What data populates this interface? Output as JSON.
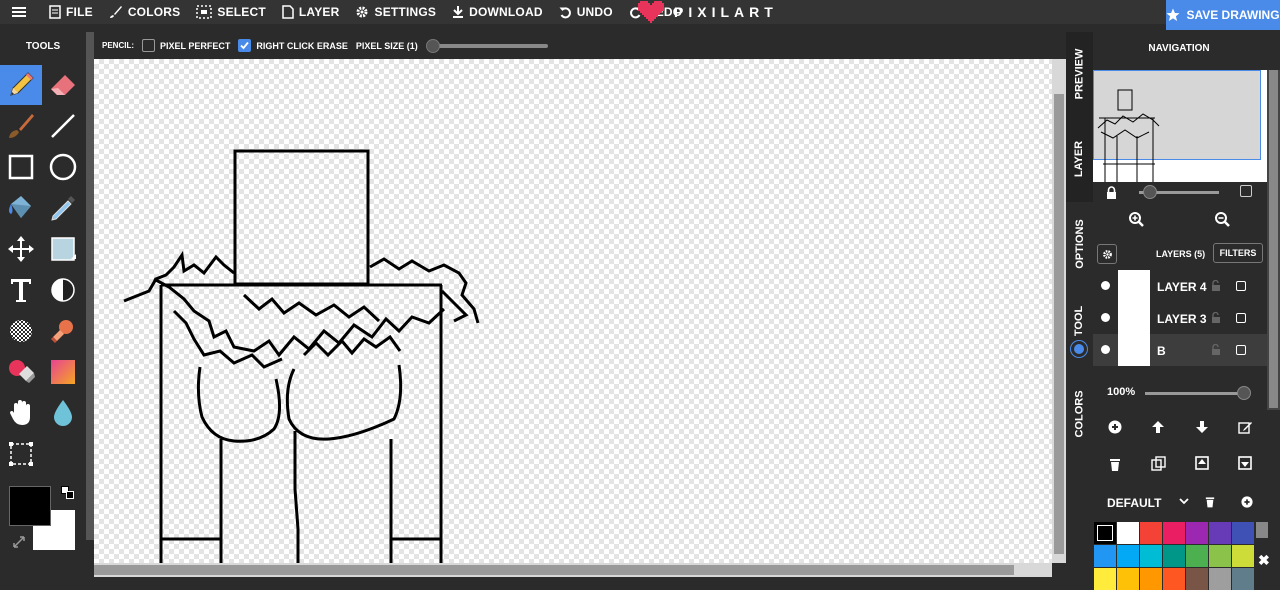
{
  "topbar": {
    "menu_icon": "hamburger-icon",
    "items": [
      {
        "label": "FILE",
        "icon": "file-icon"
      },
      {
        "label": "COLORS",
        "icon": "brush-icon"
      },
      {
        "label": "SELECT",
        "icon": "select-icon"
      },
      {
        "label": "LAYER",
        "icon": "page-icon"
      },
      {
        "label": "SETTINGS",
        "icon": "gear-icon"
      },
      {
        "label": "DOWNLOAD",
        "icon": "download-icon"
      },
      {
        "label": "UNDO",
        "icon": "undo-icon"
      },
      {
        "label": "REDO",
        "icon": "redo-icon"
      }
    ],
    "logo_text": "PIXILART",
    "save_label": "SAVE DRAWING"
  },
  "tools": {
    "title": "TOOLS",
    "list": [
      "pencil-icon",
      "eraser-icon",
      "brush-icon",
      "line-icon",
      "rectangle-icon",
      "circle-icon",
      "paint-bucket-icon",
      "eyedropper-icon",
      "move-icon",
      "select-box-icon",
      "text-icon",
      "shade-icon",
      "dither-icon",
      "stamp-icon",
      "color-replace-icon",
      "gradient-icon",
      "hand-icon",
      "blur-drop-icon",
      "crop-select-icon"
    ],
    "primary_color": "#000000",
    "secondary_color": "#ffffff"
  },
  "options": {
    "tool_label": "PENCIL:",
    "pixel_perfect_label": "PIXEL PERFECT",
    "pixel_perfect_checked": false,
    "right_click_erase_label": "RIGHT CLICK ERASE",
    "right_click_erase_checked": true,
    "pixel_size_label": "PIXEL SIZE (1)"
  },
  "side_tabs": [
    "PREVIEW",
    "LAYER",
    "OPTIONS",
    "TOOL",
    "COLORS"
  ],
  "navigation": {
    "title": "NAVIGATION"
  },
  "layers": {
    "header": "LAYERS (5)",
    "filters_label": "FILTERS",
    "items": [
      {
        "name": "LAYER 4"
      },
      {
        "name": "LAYER 3"
      },
      {
        "name": "B"
      }
    ],
    "opacity": "100%"
  },
  "palette": {
    "name": "DEFAULT",
    "colors": [
      "#000000",
      "#ffffff",
      "#f44336",
      "#e91e63",
      "#9c27b0",
      "#673ab7",
      "#3f51b5",
      "#2196f3",
      "#03a9f4",
      "#00bcd4",
      "#009688",
      "#4caf50",
      "#8bc34a",
      "#cddc39",
      "#ffeb3b",
      "#ffc107",
      "#ff9800",
      "#ff5722",
      "#795548",
      "#9e9e9e",
      "#607d8b"
    ]
  },
  "colors": {
    "accent": "#4a8be9",
    "topbar_bg": "#343434",
    "panel_bg": "#2b2b2b"
  }
}
